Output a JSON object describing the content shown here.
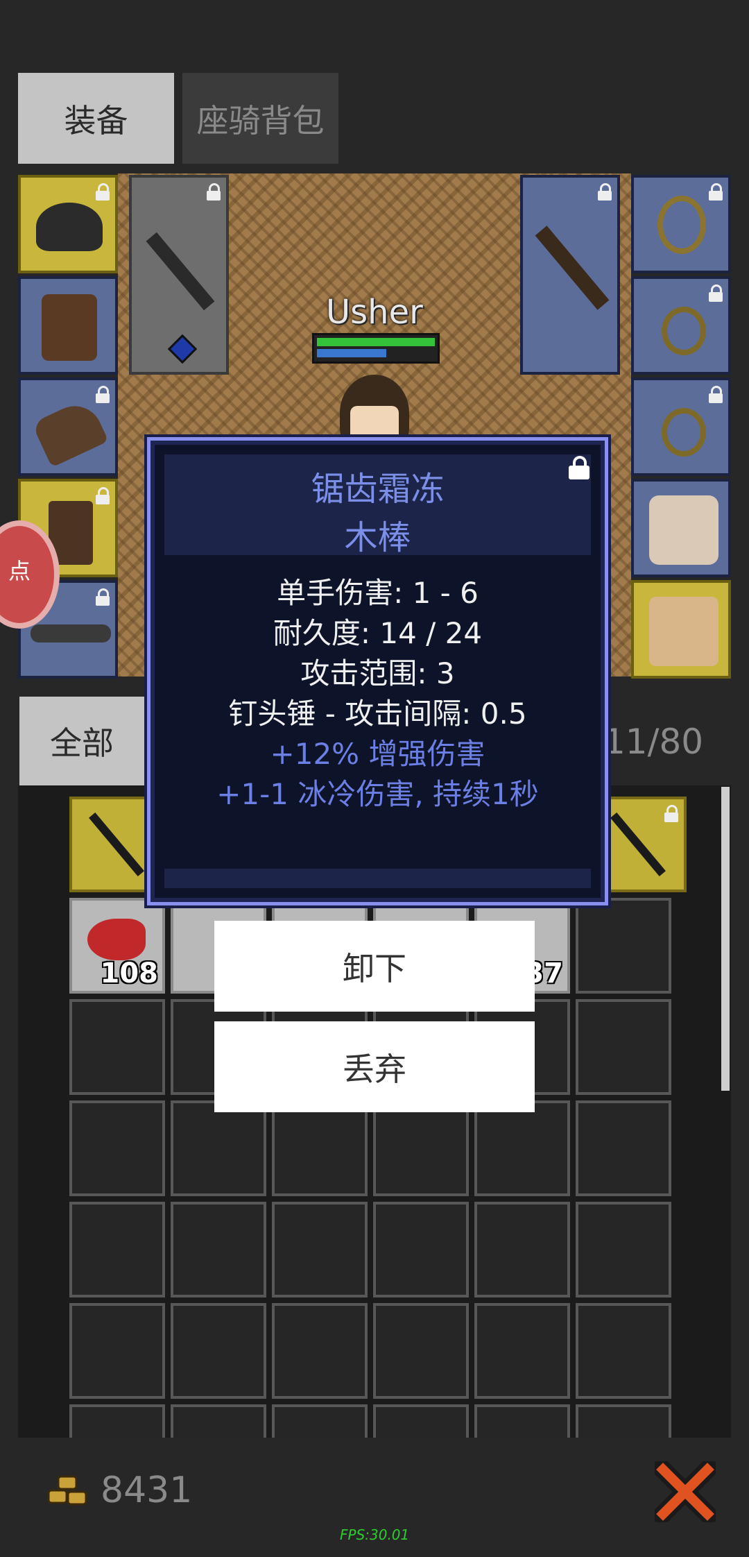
{
  "tabs": {
    "equipment": "装备",
    "mount_bag": "座骑背包"
  },
  "hero": {
    "name": "Usher",
    "hp_fraction": 1.0,
    "mp_fraction": 0.59
  },
  "side_badge": {
    "text": "点"
  },
  "bag": {
    "tab_all": "全部",
    "count": "11/80"
  },
  "bag_items": {
    "meat_qty": "108",
    "potion_qty": "37"
  },
  "popup": {
    "name1": "锯齿霜冻",
    "name2": "木棒",
    "lines": [
      "单手伤害: 1 - 6",
      "耐久度: 14 / 24",
      "攻击范围: 3",
      "钉头锤 - 攻击间隔: 0.5"
    ],
    "mods": [
      "+12% 增强伤害",
      "+1-1 冰冷伤害, 持续1秒"
    ]
  },
  "actions": {
    "unequip": "卸下",
    "discard": "丢弃"
  },
  "footer": {
    "gold": "8431",
    "fps": "FPS:30.01"
  },
  "colors": {
    "popup_title": "#7c8fe8",
    "popup_mod": "#6c7fe4",
    "gold_slot": "#c8b73c",
    "blue_slot": "#5d6d9a",
    "close": "#e0521f"
  }
}
